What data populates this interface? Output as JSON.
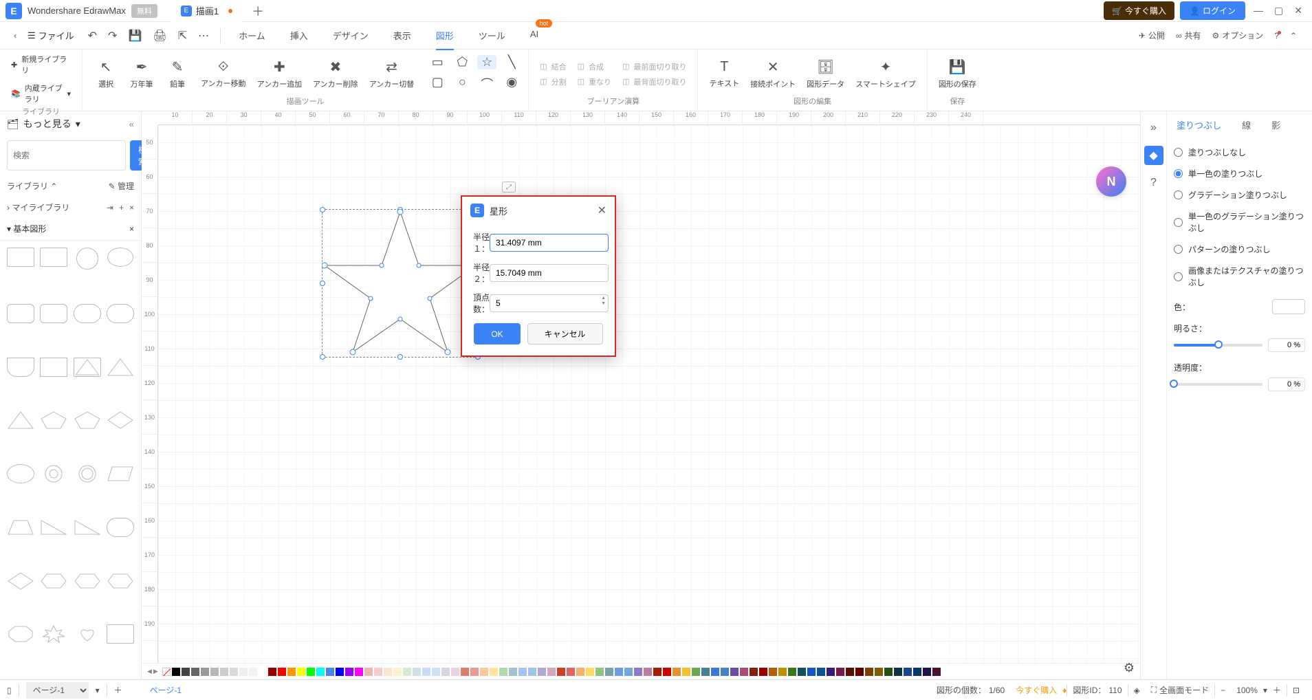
{
  "app": {
    "title": "Wondershare EdrawMax",
    "free_badge": "無料"
  },
  "tab": {
    "name": "描画1"
  },
  "titlebar_buttons": {
    "buy": "今すぐ購入",
    "login": "ログイン"
  },
  "file_menu": "ファイル",
  "menus": [
    "ホーム",
    "挿入",
    "デザイン",
    "表示",
    "図形",
    "ツール",
    "AI"
  ],
  "menu_active_index": 4,
  "hot_label": "hot",
  "menubar_right": {
    "publish": "公開",
    "share": "共有",
    "option": "オプション"
  },
  "ribbon": {
    "library": {
      "new": "新規ライブラリ",
      "builtin": "内蔵ライブラリ",
      "label": "ライブラリ"
    },
    "drawtools": {
      "select": "選択",
      "pen": "万年筆",
      "pencil": "鉛筆",
      "anchor_move": "アンカー移動",
      "anchor_add": "アンカー追加",
      "anchor_del": "アンカー削除",
      "anchor_switch": "アンカー切替",
      "label": "描画ツール"
    },
    "boolean": {
      "combine": "結合",
      "synth": "合成",
      "front_clip": "最前面切り取り",
      "split": "分割",
      "overlap": "重なり",
      "back_clip": "最背面切り取り",
      "label": "ブーリアン演算"
    },
    "edit": {
      "text": "テキスト",
      "connect": "接続ポイント",
      "shapedata": "図形データ",
      "smart": "スマートシェイプ",
      "label": "図形の編集"
    },
    "save": {
      "save_shape": "図形の保存",
      "label": "保存"
    }
  },
  "sidebar_left": {
    "more": "もっと見る",
    "search_placeholder": "検索",
    "search_btn": "検索",
    "library_label": "ライブラリ",
    "manage": "管理",
    "my_library": "マイライブラリ",
    "basic_shapes": "基本図形"
  },
  "ruler_h": [
    "10",
    "20",
    "30",
    "40",
    "50",
    "60",
    "70",
    "80",
    "90",
    "100",
    "110",
    "120",
    "130",
    "140",
    "150",
    "160",
    "170",
    "180",
    "190",
    "200",
    "210",
    "220",
    "230",
    "240"
  ],
  "ruler_v": [
    "50",
    "60",
    "70",
    "80",
    "90",
    "100",
    "110",
    "120",
    "130",
    "140",
    "150",
    "160",
    "170",
    "180",
    "190"
  ],
  "dialog": {
    "title": "星形",
    "radius1_label": "半径１：",
    "radius1_value": "31.4097 mm",
    "radius2_label": "半径２：",
    "radius2_value": "15.7049 mm",
    "vertices_label": "頂点数：",
    "vertices_value": "5",
    "ok": "OK",
    "cancel": "キャンセル"
  },
  "right_panel": {
    "tabs": [
      "塗りつぶし",
      "線",
      "影"
    ],
    "active_tab": 0,
    "fill_options": [
      "塗りつぶしなし",
      "単一色の塗りつぶし",
      "グラデーション塗りつぶし",
      "単一色のグラデーション塗りつぶし",
      "パターンの塗りつぶし",
      "画像またはテクスチャの塗りつぶし"
    ],
    "fill_selected": 1,
    "color_label": "色：",
    "brightness_label": "明るさ：",
    "brightness_value": "0 %",
    "opacity_label": "透明度：",
    "opacity_value": "0 %"
  },
  "colors": [
    "#000000",
    "#434343",
    "#666666",
    "#999999",
    "#b7b7b7",
    "#cccccc",
    "#d9d9d9",
    "#efefef",
    "#f3f3f3",
    "#ffffff",
    "#980000",
    "#ff0000",
    "#ff9900",
    "#ffff00",
    "#00ff00",
    "#00ffff",
    "#4a86e8",
    "#0000ff",
    "#9900ff",
    "#ff00ff",
    "#e6b8af",
    "#f4cccc",
    "#fce5cd",
    "#fff2cc",
    "#d9ead3",
    "#d0e0e3",
    "#c9daf8",
    "#cfe2f3",
    "#d9d2e9",
    "#ead1dc",
    "#dd7e6b",
    "#ea9999",
    "#f9cb9c",
    "#ffe599",
    "#b6d7a8",
    "#a2c4c9",
    "#a4c2f4",
    "#9fc5e8",
    "#b4a7d6",
    "#d5a6bd",
    "#cc4125",
    "#e06666",
    "#f6b26b",
    "#ffd966",
    "#93c47d",
    "#76a5af",
    "#6d9eeb",
    "#6fa8dc",
    "#8e7cc3",
    "#c27ba0",
    "#a61c00",
    "#cc0000",
    "#e69138",
    "#f1c232",
    "#6aa84f",
    "#45818e",
    "#3c78d8",
    "#3d85c6",
    "#674ea7",
    "#a64d79",
    "#85200c",
    "#990000",
    "#b45f06",
    "#bf9000",
    "#38761d",
    "#134f5c",
    "#1155cc",
    "#0b5394",
    "#351c75",
    "#741b47",
    "#5b0f00",
    "#660000",
    "#783f04",
    "#7f6000",
    "#274e13",
    "#0c343d",
    "#1c4587",
    "#073763",
    "#20124d",
    "#4c1130"
  ],
  "statusbar": {
    "page": "ページ-1",
    "page_tab": "ページ-1",
    "shape_count_label": "図形の個数：",
    "shape_count": "1/60",
    "buy_now": "今すぐ購入",
    "shape_id_label": "図形ID：",
    "shape_id": "110",
    "fullscreen": "全画面モード",
    "zoom": "100%"
  }
}
